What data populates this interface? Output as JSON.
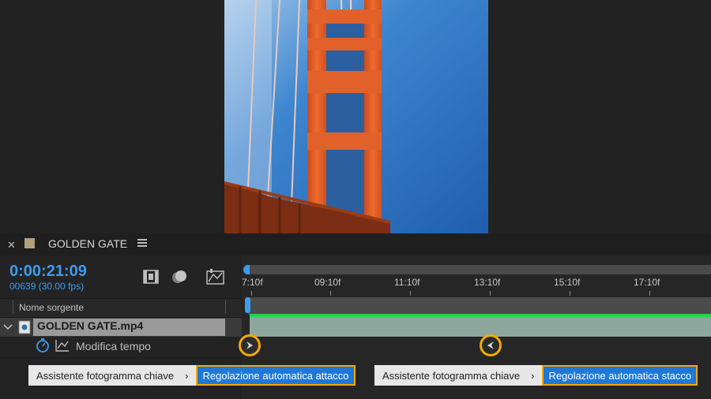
{
  "composition": {
    "name": "GOLDEN GATE",
    "swatch_color": "#b29f7d"
  },
  "time": {
    "timecode": "0:00:21:09",
    "frames_fps": "00639 (30.00 fps)"
  },
  "columns": {
    "source_name": "Nome sorgente"
  },
  "layer": {
    "name": "GOLDEN GATE.mp4",
    "property": "Modifica tempo"
  },
  "ruler": {
    "ticks": [
      "7:10f",
      "09:10f",
      "11:10f",
      "13:10f",
      "15:10f",
      "17:10f"
    ]
  },
  "menus": [
    {
      "parent": "Assistente fotogramma chiave",
      "item": "Regolazione automatica attacco"
    },
    {
      "parent": "Assistente fotogramma chiave",
      "item": "Regolazione automatica stacco"
    }
  ],
  "colors": {
    "accent_blue": "#3a9df0",
    "highlight": "#f2a900",
    "layer_green": "#2bd14d"
  }
}
